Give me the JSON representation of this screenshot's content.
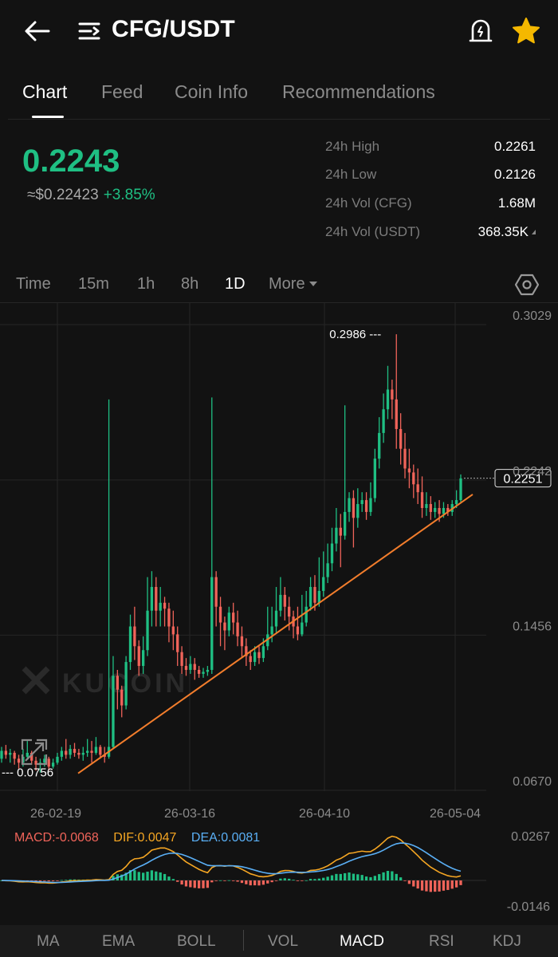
{
  "header": {
    "pair": "CFG/USDT",
    "icons": [
      "back-arrow-icon",
      "menu-icon",
      "price-alert-icon",
      "favorite-star-icon"
    ],
    "star_color": "#f5b800"
  },
  "tabs": [
    "Chart",
    "Feed",
    "Coin Info",
    "Recommendations"
  ],
  "ticker": {
    "last_price": "0.2243",
    "usd_price": "≈$0.22423",
    "change": "+3.85%",
    "up_color": "#1fbf83",
    "stats": [
      {
        "label": "24h High",
        "value": "0.2261"
      },
      {
        "label": "24h Low",
        "value": "0.2126"
      },
      {
        "label": "24h Vol (CFG)",
        "value": "1.68M"
      },
      {
        "label": "24h Vol (USDT)",
        "value": "368.35K"
      }
    ]
  },
  "timeframes": [
    "Time",
    "15m",
    "1h",
    "8h",
    "1D",
    "More"
  ],
  "active_timeframe": "1D",
  "chart_data": {
    "type": "candlestick",
    "pair": "CFG/USDT",
    "interval": "1D",
    "y_ticks": [
      "0.3029",
      "0.2242",
      "0.1456",
      "0.0670"
    ],
    "ylim": [
      0.067,
      0.3029
    ],
    "x_ticks": [
      "26-02-19",
      "26-03-16",
      "26-04-10",
      "26-05-04"
    ],
    "high_marker": "0.2986 ---",
    "low_marker": "--- 0.0756",
    "current_price_tag": "0.2251",
    "watermark": "KUCOIN",
    "up_color": "#1fbf83",
    "down_color": "#f0645a",
    "trendline_color": "#f27d2c",
    "candles": [
      [
        0.083,
        0.087,
        0.081,
        0.089
      ],
      [
        0.087,
        0.085,
        0.083,
        0.09
      ],
      [
        0.085,
        0.086,
        0.081,
        0.088
      ],
      [
        0.086,
        0.083,
        0.08,
        0.087
      ],
      [
        0.083,
        0.081,
        0.078,
        0.085
      ],
      [
        0.081,
        0.084,
        0.079,
        0.088
      ],
      [
        0.084,
        0.086,
        0.083,
        0.092
      ],
      [
        0.086,
        0.082,
        0.08,
        0.087
      ],
      [
        0.082,
        0.08,
        0.077,
        0.084
      ],
      [
        0.08,
        0.081,
        0.076,
        0.083
      ],
      [
        0.081,
        0.083,
        0.079,
        0.085
      ],
      [
        0.083,
        0.079,
        0.077,
        0.084
      ],
      [
        0.079,
        0.081,
        0.078,
        0.083
      ],
      [
        0.081,
        0.084,
        0.08,
        0.086
      ],
      [
        0.084,
        0.087,
        0.082,
        0.089
      ],
      [
        0.087,
        0.085,
        0.083,
        0.093
      ],
      [
        0.085,
        0.088,
        0.083,
        0.09
      ],
      [
        0.088,
        0.086,
        0.084,
        0.091
      ],
      [
        0.086,
        0.085,
        0.083,
        0.088
      ],
      [
        0.085,
        0.086,
        0.082,
        0.089
      ],
      [
        0.086,
        0.087,
        0.084,
        0.093
      ],
      [
        0.087,
        0.086,
        0.081,
        0.092
      ],
      [
        0.086,
        0.089,
        0.085,
        0.094
      ],
      [
        0.089,
        0.085,
        0.083,
        0.09
      ],
      [
        0.085,
        0.084,
        0.081,
        0.089
      ],
      [
        0.084,
        0.089,
        0.083,
        0.265
      ],
      [
        0.089,
        0.125,
        0.088,
        0.135
      ],
      [
        0.125,
        0.118,
        0.108,
        0.128
      ],
      [
        0.118,
        0.11,
        0.104,
        0.12
      ],
      [
        0.11,
        0.132,
        0.108,
        0.135
      ],
      [
        0.132,
        0.15,
        0.128,
        0.156
      ],
      [
        0.15,
        0.14,
        0.133,
        0.16
      ],
      [
        0.14,
        0.13,
        0.125,
        0.143
      ],
      [
        0.13,
        0.138,
        0.126,
        0.145
      ],
      [
        0.138,
        0.158,
        0.135,
        0.175
      ],
      [
        0.158,
        0.17,
        0.15,
        0.178
      ],
      [
        0.17,
        0.158,
        0.15,
        0.175
      ],
      [
        0.158,
        0.162,
        0.15,
        0.17
      ],
      [
        0.162,
        0.159,
        0.15,
        0.165
      ],
      [
        0.159,
        0.15,
        0.142,
        0.162
      ],
      [
        0.15,
        0.146,
        0.138,
        0.158
      ],
      [
        0.146,
        0.137,
        0.13,
        0.15
      ],
      [
        0.137,
        0.13,
        0.126,
        0.14
      ],
      [
        0.13,
        0.128,
        0.125,
        0.134
      ],
      [
        0.128,
        0.131,
        0.126,
        0.135
      ],
      [
        0.131,
        0.128,
        0.123,
        0.134
      ],
      [
        0.128,
        0.126,
        0.124,
        0.13
      ],
      [
        0.126,
        0.127,
        0.124,
        0.129
      ],
      [
        0.127,
        0.128,
        0.125,
        0.13
      ],
      [
        0.128,
        0.175,
        0.126,
        0.266
      ],
      [
        0.175,
        0.16,
        0.15,
        0.178
      ],
      [
        0.16,
        0.152,
        0.14,
        0.165
      ],
      [
        0.152,
        0.148,
        0.138,
        0.155
      ],
      [
        0.148,
        0.157,
        0.145,
        0.16
      ],
      [
        0.157,
        0.152,
        0.146,
        0.162
      ],
      [
        0.152,
        0.145,
        0.14,
        0.158
      ],
      [
        0.145,
        0.14,
        0.134,
        0.15
      ],
      [
        0.14,
        0.135,
        0.13,
        0.144
      ],
      [
        0.135,
        0.132,
        0.128,
        0.138
      ],
      [
        0.132,
        0.137,
        0.13,
        0.14
      ],
      [
        0.137,
        0.134,
        0.131,
        0.14
      ],
      [
        0.134,
        0.14,
        0.132,
        0.144
      ],
      [
        0.14,
        0.146,
        0.138,
        0.16
      ],
      [
        0.146,
        0.15,
        0.142,
        0.16
      ],
      [
        0.15,
        0.158,
        0.147,
        0.17
      ],
      [
        0.158,
        0.166,
        0.155,
        0.175
      ],
      [
        0.166,
        0.16,
        0.153,
        0.17
      ],
      [
        0.16,
        0.155,
        0.148,
        0.165
      ],
      [
        0.155,
        0.15,
        0.144,
        0.158
      ],
      [
        0.15,
        0.146,
        0.143,
        0.16
      ],
      [
        0.146,
        0.152,
        0.145,
        0.166
      ],
      [
        0.152,
        0.16,
        0.15,
        0.168
      ],
      [
        0.16,
        0.17,
        0.158,
        0.175
      ],
      [
        0.17,
        0.162,
        0.158,
        0.176
      ],
      [
        0.162,
        0.168,
        0.16,
        0.185
      ],
      [
        0.168,
        0.175,
        0.165,
        0.188
      ],
      [
        0.175,
        0.182,
        0.172,
        0.192
      ],
      [
        0.182,
        0.192,
        0.178,
        0.2
      ],
      [
        0.192,
        0.2,
        0.188,
        0.21
      ],
      [
        0.2,
        0.196,
        0.18,
        0.207
      ],
      [
        0.196,
        0.208,
        0.194,
        0.262
      ],
      [
        0.208,
        0.215,
        0.203,
        0.218
      ],
      [
        0.215,
        0.205,
        0.19,
        0.219
      ],
      [
        0.205,
        0.212,
        0.2,
        0.22
      ],
      [
        0.212,
        0.214,
        0.208,
        0.218
      ],
      [
        0.214,
        0.208,
        0.204,
        0.218
      ],
      [
        0.208,
        0.215,
        0.206,
        0.223
      ],
      [
        0.215,
        0.235,
        0.213,
        0.24
      ],
      [
        0.235,
        0.248,
        0.23,
        0.256
      ],
      [
        0.248,
        0.26,
        0.243,
        0.268
      ],
      [
        0.26,
        0.27,
        0.255,
        0.282
      ],
      [
        0.27,
        0.265,
        0.255,
        0.275
      ],
      [
        0.265,
        0.25,
        0.24,
        0.298
      ],
      [
        0.25,
        0.24,
        0.232,
        0.258
      ],
      [
        0.24,
        0.23,
        0.225,
        0.248
      ],
      [
        0.23,
        0.228,
        0.22,
        0.24
      ],
      [
        0.228,
        0.222,
        0.215,
        0.232
      ],
      [
        0.222,
        0.218,
        0.212,
        0.23
      ],
      [
        0.218,
        0.21,
        0.205,
        0.226
      ],
      [
        0.21,
        0.212,
        0.206,
        0.218
      ],
      [
        0.212,
        0.208,
        0.204,
        0.216
      ],
      [
        0.208,
        0.21,
        0.205,
        0.213
      ],
      [
        0.21,
        0.207,
        0.203,
        0.214
      ],
      [
        0.207,
        0.21,
        0.205,
        0.213
      ],
      [
        0.21,
        0.208,
        0.206,
        0.212
      ],
      [
        0.208,
        0.212,
        0.206,
        0.214
      ],
      [
        0.212,
        0.214,
        0.21,
        0.219
      ],
      [
        0.214,
        0.225,
        0.213,
        0.227
      ]
    ],
    "trendline": [
      [
        0.0756,
        0.2169
      ]
    ]
  },
  "macd": {
    "macd_label": "MACD:-0.0068",
    "dif_label": "DIF:0.0047",
    "dea_label": "DEA:0.0081",
    "macd_color": "#f0645a",
    "dif_color": "#f5a623",
    "dea_color": "#5aaff5",
    "y_ticks": [
      "0.0267",
      "-0.0146"
    ]
  },
  "indicators": [
    "MA",
    "EMA",
    "BOLL",
    "VOL",
    "MACD",
    "RSI",
    "KDJ"
  ],
  "active_indicator": "MACD"
}
